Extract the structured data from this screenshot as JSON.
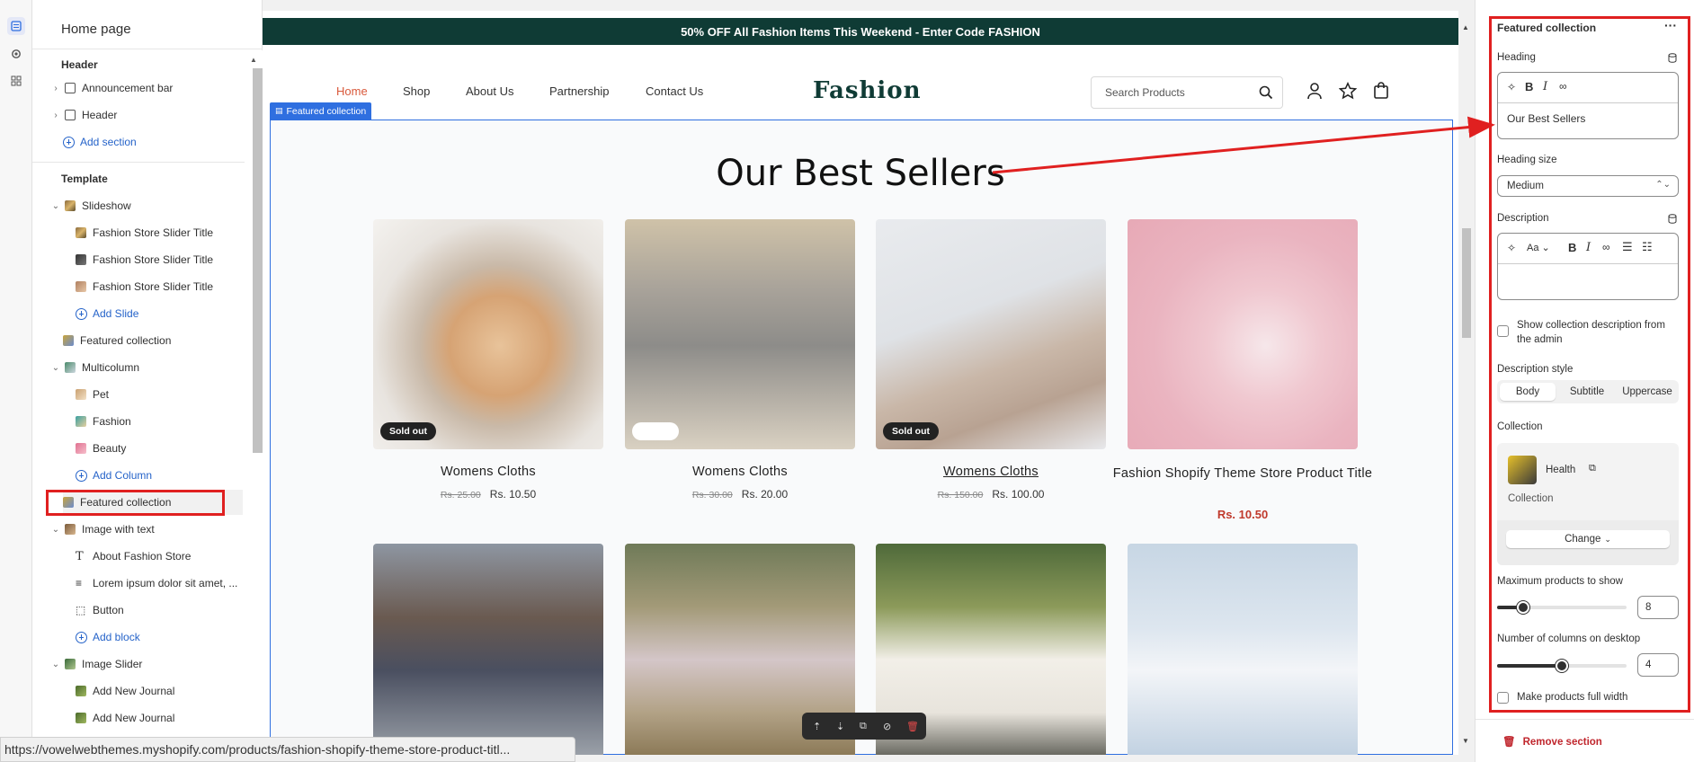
{
  "left_panel": {
    "title": "Home page",
    "header_group": "Header",
    "announcement_bar": "Announcement bar",
    "header": "Header",
    "add_section": "Add section",
    "template_group": "Template",
    "slideshow": "Slideshow",
    "slide1": "Fashion Store Slider Title",
    "slide2": "Fashion Store Slider Title",
    "slide3": "Fashion Store Slider Title",
    "add_slide": "Add Slide",
    "featured_collection_1": "Featured collection",
    "multicolumn": "Multicolumn",
    "col_pet": "Pet",
    "col_fashion": "Fashion",
    "col_beauty": "Beauty",
    "add_column": "Add Column",
    "featured_collection_2": "Featured collection",
    "image_with_text": "Image with text",
    "about_store": "About Fashion Store",
    "lorem": "Lorem ipsum dolor sit amet, ...",
    "button": "Button",
    "add_block": "Add block",
    "image_slider": "Image Slider",
    "journal1": "Add New Journal",
    "journal2": "Add New Journal"
  },
  "preview": {
    "announcement_text": "50% OFF All Fashion Items This Weekend - Enter Code ",
    "announcement_code": "FASHION",
    "nav": [
      "Home",
      "Shop",
      "About Us",
      "Partnership",
      "Contact Us"
    ],
    "logo": "Fashion",
    "search_placeholder": "Search Products",
    "section_tag": "Featured collection",
    "heading": "Our Best Sellers",
    "products": [
      {
        "title": "Womens Cloths",
        "compare_price": "Rs. 25.00",
        "price": "Rs. 10.50",
        "badge": "Sold out"
      },
      {
        "title": "Womens Cloths",
        "compare_price": "Rs. 30.00",
        "price": "Rs. 20.00",
        "badge": ""
      },
      {
        "title": "Womens Cloths",
        "compare_price": "Rs. 150.00",
        "price": "Rs. 100.00",
        "badge": "Sold out"
      },
      {
        "title": "Fashion Shopify Theme Store Product Title",
        "compare_price": "",
        "price": "Rs. 10.50",
        "badge": ""
      }
    ]
  },
  "right_panel": {
    "title": "Featured collection",
    "heading_label": "Heading",
    "heading_value": "Our Best Sellers",
    "heading_size_label": "Heading size",
    "heading_size_value": "Medium",
    "description_label": "Description",
    "show_desc_label": "Show collection description from the admin",
    "desc_style_label": "Description style",
    "desc_styles": [
      "Body",
      "Subtitle",
      "Uppercase"
    ],
    "desc_style_selected": "Body",
    "collection_label": "Collection",
    "collection_name": "Health",
    "collection_type": "Collection",
    "change_button": "Change",
    "max_products_label": "Maximum products to show",
    "max_products_value": "8",
    "max_products_fraction": 0.2,
    "columns_label": "Number of columns on desktop",
    "columns_value": "4",
    "columns_fraction": 0.5,
    "full_width_label": "Make products full width",
    "remove_section": "Remove section"
  },
  "status_url": "https://vowelwebthemes.myshopify.com/products/fashion-shopify-theme-store-product-titl...",
  "colors": {
    "accent": "#2f6fe0",
    "highlight": "#e02020",
    "announce_bg": "#0f3b35",
    "nav_active": "#d9593b"
  }
}
